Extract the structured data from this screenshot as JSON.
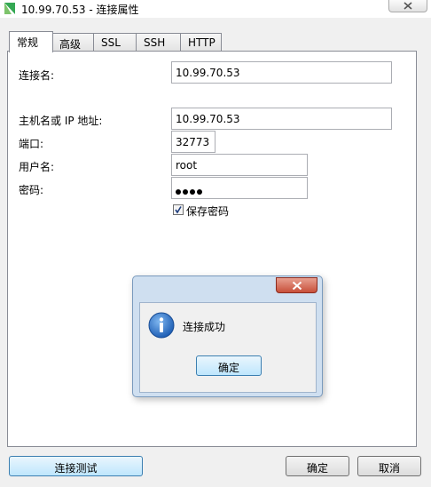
{
  "window": {
    "title": "10.99.70.53 - 连接属性"
  },
  "tabs": [
    {
      "label": "常规",
      "active": true
    },
    {
      "label": "高级",
      "active": false
    },
    {
      "label": "SSL",
      "active": false
    },
    {
      "label": "SSH",
      "active": false
    },
    {
      "label": "HTTP",
      "active": false
    }
  ],
  "form": {
    "conn_name_label": "连接名:",
    "conn_name_value": "10.99.70.53",
    "host_label": "主机名或 IP 地址:",
    "host_value": "10.99.70.53",
    "port_label": "端口:",
    "port_value": "32773",
    "user_label": "用户名:",
    "user_value": "root",
    "password_label": "密码:",
    "password_length": 4,
    "save_password_label": "保存密码",
    "save_password_checked": true
  },
  "buttons": {
    "test": "连接测试",
    "ok": "确定",
    "cancel": "取消"
  },
  "dialog": {
    "message": "连接成功",
    "ok": "确定"
  },
  "colors": {
    "app_icon": "#34a853",
    "info_icon": "#1f6fc5",
    "dialog_close": "#c8503a"
  }
}
